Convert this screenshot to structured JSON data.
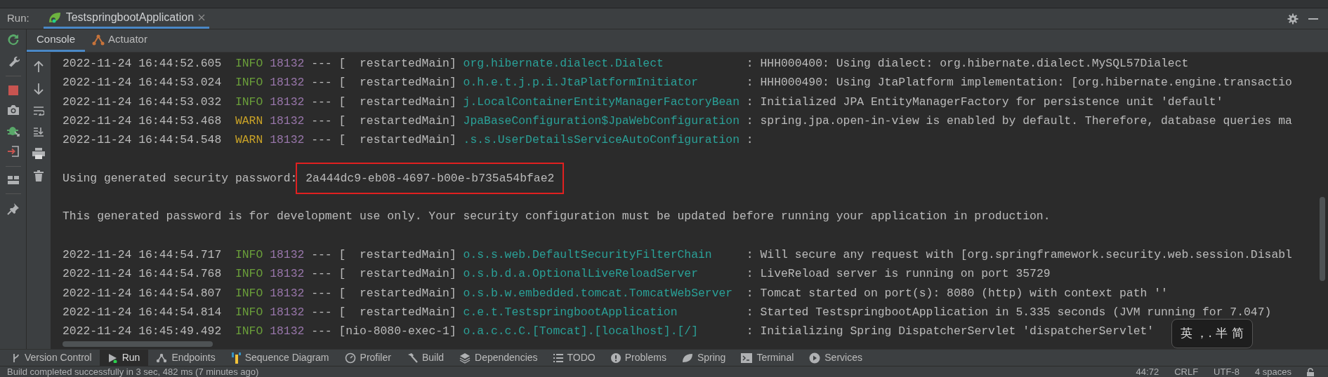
{
  "run_bar": {
    "label": "Run:",
    "tabs": [
      {
        "label": "TestspringbootApplication",
        "selected": true
      }
    ]
  },
  "console_tabs": [
    {
      "label": "Console",
      "selected": true
    },
    {
      "label": "Actuator",
      "selected": false
    }
  ],
  "console": {
    "lines": [
      {
        "kind": "log",
        "timestamp": "2022-11-24 16:44:52.605",
        "level": "INFO",
        "pid": "18132",
        "separator": "---",
        "thread": "[  restartedMain]",
        "logger": "org.hibernate.dialect.Dialect",
        "message": ": HHH000400: Using dialect: org.hibernate.dialect.MySQL57Dialect"
      },
      {
        "kind": "log",
        "timestamp": "2022-11-24 16:44:53.024",
        "level": "INFO",
        "pid": "18132",
        "separator": "---",
        "thread": "[  restartedMain]",
        "logger": "o.h.e.t.j.p.i.JtaPlatformInitiator",
        "message": ": HHH000490: Using JtaPlatform implementation: [org.hibernate.engine.transactio"
      },
      {
        "kind": "log",
        "timestamp": "2022-11-24 16:44:53.032",
        "level": "INFO",
        "pid": "18132",
        "separator": "---",
        "thread": "[  restartedMain]",
        "logger": "j.LocalContainerEntityManagerFactoryBean",
        "message": ": Initialized JPA EntityManagerFactory for persistence unit 'default'"
      },
      {
        "kind": "log",
        "timestamp": "2022-11-24 16:44:53.468",
        "level": "WARN",
        "pid": "18132",
        "separator": "---",
        "thread": "[  restartedMain]",
        "logger": "JpaBaseConfiguration$JpaWebConfiguration",
        "message": ": spring.jpa.open-in-view is enabled by default. Therefore, database queries ma"
      },
      {
        "kind": "log",
        "timestamp": "2022-11-24 16:44:54.548",
        "level": "WARN",
        "pid": "18132",
        "separator": "---",
        "thread": "[  restartedMain]",
        "logger": ".s.s.UserDetailsServiceAutoConfiguration",
        "message": ":"
      },
      {
        "kind": "blank"
      },
      {
        "kind": "password",
        "label": "Using generated security password:",
        "value": "2a444dc9-eb08-4697-b00e-b735a54bfae2",
        "highlighted": true
      },
      {
        "kind": "blank"
      },
      {
        "kind": "text",
        "text": "This generated password is for development use only. Your security configuration must be updated before running your application in production."
      },
      {
        "kind": "blank"
      },
      {
        "kind": "log",
        "timestamp": "2022-11-24 16:44:54.717",
        "level": "INFO",
        "pid": "18132",
        "separator": "---",
        "thread": "[  restartedMain]",
        "logger": "o.s.s.web.DefaultSecurityFilterChain",
        "message": ": Will secure any request with [org.springframework.security.web.session.Disabl"
      },
      {
        "kind": "log",
        "timestamp": "2022-11-24 16:44:54.768",
        "level": "INFO",
        "pid": "18132",
        "separator": "---",
        "thread": "[  restartedMain]",
        "logger": "o.s.b.d.a.OptionalLiveReloadServer",
        "message": ": LiveReload server is running on port 35729"
      },
      {
        "kind": "log",
        "timestamp": "2022-11-24 16:44:54.807",
        "level": "INFO",
        "pid": "18132",
        "separator": "---",
        "thread": "[  restartedMain]",
        "logger": "o.s.b.w.embedded.tomcat.TomcatWebServer",
        "message": ": Tomcat started on port(s): 8080 (http) with context path ''"
      },
      {
        "kind": "log",
        "timestamp": "2022-11-24 16:44:54.814",
        "level": "INFO",
        "pid": "18132",
        "separator": "---",
        "thread": "[  restartedMain]",
        "logger": "c.e.t.TestspringbootApplication",
        "message": ": Started TestspringbootApplication in 5.335 seconds (JVM running for 7.047)"
      },
      {
        "kind": "log",
        "timestamp": "2022-11-24 16:45:49.492",
        "level": "INFO",
        "pid": "18132",
        "separator": "---",
        "thread": "[nio-8080-exec-1]",
        "logger": "o.a.c.c.C.[Tomcat].[localhost].[/]",
        "message": ": Initializing Spring DispatcherServlet 'dispatcherServlet'"
      }
    ]
  },
  "ime_indicator": {
    "text": "英 ，. 半 简"
  },
  "tool_windows": [
    {
      "label": "Version Control",
      "selected": false
    },
    {
      "label": "Run",
      "selected": true
    },
    {
      "label": "Endpoints",
      "selected": false
    },
    {
      "label": "Sequence Diagram",
      "selected": false
    },
    {
      "label": "Profiler",
      "selected": false
    },
    {
      "label": "Build",
      "selected": false
    },
    {
      "label": "Dependencies",
      "selected": false
    },
    {
      "label": "TODO",
      "selected": false
    },
    {
      "label": "Problems",
      "selected": false
    },
    {
      "label": "Spring",
      "selected": false
    },
    {
      "label": "Terminal",
      "selected": false
    },
    {
      "label": "Services",
      "selected": false
    }
  ],
  "status_bar": {
    "message": "Build completed successfully in 3 sec, 482 ms (7 minutes ago)",
    "position": "44:72",
    "line_separator": "CRLF",
    "encoding": "UTF-8",
    "indent": "4 spaces"
  }
}
